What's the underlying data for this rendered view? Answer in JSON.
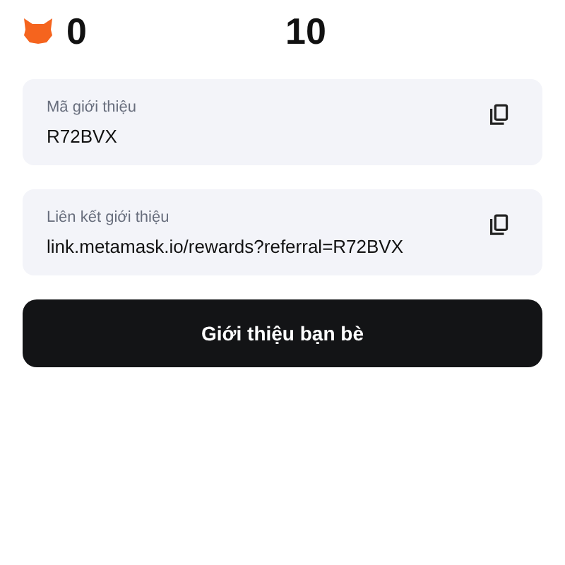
{
  "stats": [
    {
      "value": "0"
    },
    {
      "value": "10"
    }
  ],
  "fields": [
    {
      "label": "Mã giới thiệu",
      "value": "R72BVX"
    },
    {
      "label": "Liên kết giới thiệu",
      "value": "link.metamask.io/rewards?referral=R72BVX"
    }
  ],
  "button": "Giới thiệu bạn bè"
}
